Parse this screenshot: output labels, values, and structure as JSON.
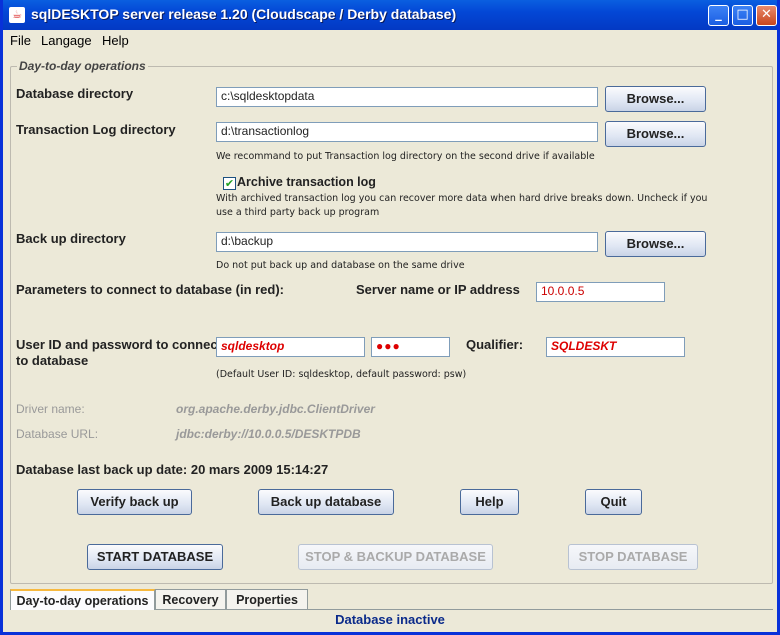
{
  "window": {
    "title": "sqlDESKTOP server release 1.20 (Cloudscape / Derby database)"
  },
  "menu": {
    "file": "File",
    "language": "Langage",
    "help": "Help"
  },
  "group_title": "Day-to-day operations",
  "database_dir": {
    "label": "Database directory",
    "value": "c:\\sqldesktopdata",
    "browse": "Browse..."
  },
  "log_dir": {
    "label": "Transaction Log directory",
    "value": "d:\\transactionlog",
    "browse": "Browse...",
    "hint": "We recommand to put Transaction log directory on the second drive if available"
  },
  "archive": {
    "checked": true,
    "label": "Archive transaction log",
    "hint1": "With archived transaction log you can recover more data when hard drive breaks down. Uncheck if you",
    "hint2": "use a third party back up program"
  },
  "backup_dir": {
    "label": "Back up directory",
    "value": "d:\\backup",
    "browse": "Browse...",
    "hint": "Do not put back up and database on the same drive"
  },
  "params": {
    "label": "Parameters to connect to database (in red):",
    "server_label": "Server name or IP address",
    "server_value": "10.0.0.5"
  },
  "credentials": {
    "label1": "User ID and password to connect",
    "label2": "to database",
    "user": "sqldesktop",
    "password": "●●●",
    "qualifier_label": "Qualifier:",
    "qualifier": "SQLDESKT",
    "hint": "(Default User ID: sqldesktop, default password: psw)"
  },
  "driver": {
    "label": "Driver name:",
    "value": "org.apache.derby.jdbc.ClientDriver"
  },
  "url": {
    "label": "Database URL:",
    "value": "jdbc:derby://10.0.0.5/DESKTPDB"
  },
  "last_backup": "Database last back up date: 20 mars 2009 15:14:27",
  "buttons": {
    "verify": "Verify back up",
    "backup": "Back up database",
    "help": "Help",
    "quit": "Quit",
    "start": "START DATABASE",
    "stop_backup": "STOP & BACKUP DATABASE",
    "stop": "STOP DATABASE"
  },
  "tabs": [
    "Day-to-day operations",
    "Recovery",
    "Properties"
  ],
  "status": "Database inactive"
}
